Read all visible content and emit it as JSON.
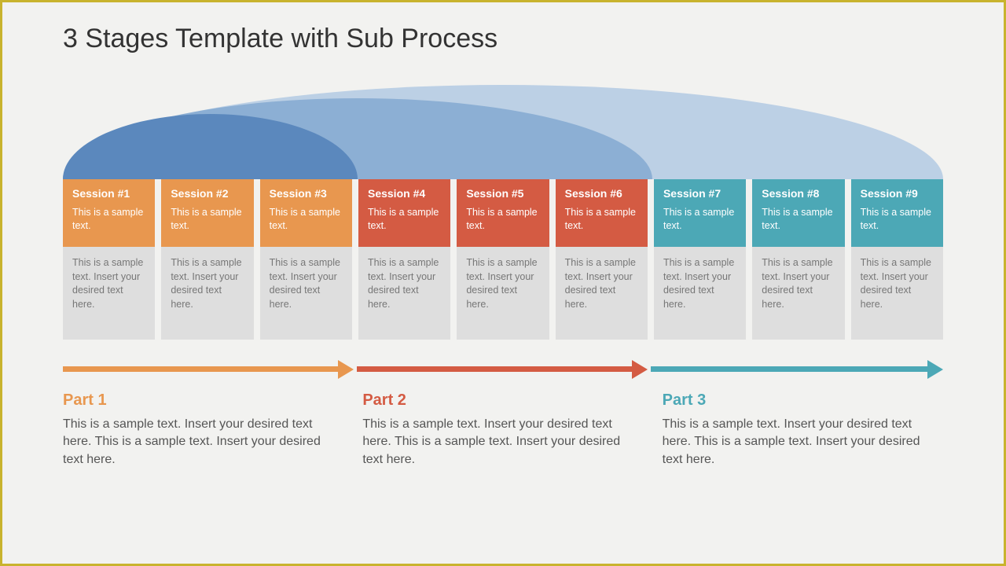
{
  "title": "3 Stages Template with Sub Process",
  "sessions": [
    {
      "title": "Session #1",
      "sub": "This is a sample text.",
      "detail": "This is a sample text. Insert your desired text here.",
      "tone": "orange"
    },
    {
      "title": "Session #2",
      "sub": "This is a sample text.",
      "detail": "This is a sample text. Insert your desired text here.",
      "tone": "orange"
    },
    {
      "title": "Session #3",
      "sub": "This is a sample text.",
      "detail": "This is a sample text. Insert your desired text here.",
      "tone": "orange"
    },
    {
      "title": "Session #4",
      "sub": "This is a sample text.",
      "detail": "This is a sample text. Insert your desired text here.",
      "tone": "red"
    },
    {
      "title": "Session #5",
      "sub": "This is a sample text.",
      "detail": "This is a sample text. Insert your desired text here.",
      "tone": "red"
    },
    {
      "title": "Session #6",
      "sub": "This is a sample text.",
      "detail": "This is a sample text. Insert your desired text here.",
      "tone": "red"
    },
    {
      "title": "Session #7",
      "sub": "This is a sample text.",
      "detail": "This is a sample text. Insert your desired text here.",
      "tone": "teal"
    },
    {
      "title": "Session #8",
      "sub": "This is a sample text.",
      "detail": "This is a sample text. Insert your desired text here.",
      "tone": "teal"
    },
    {
      "title": "Session #9",
      "sub": "This is a sample text.",
      "detail": "This is a sample text. Insert your desired text here.",
      "tone": "teal"
    }
  ],
  "parts": [
    {
      "title": "Part 1",
      "body": "This is a sample text.  Insert your desired text here. This is a sample text. Insert your desired text here.",
      "tone": "orange"
    },
    {
      "title": "Part 2",
      "body": "This is a sample text.  Insert your desired text here. This is a sample text. Insert your desired text here.",
      "tone": "red"
    },
    {
      "title": "Part 3",
      "body": "This is a sample text.  Insert your desired text here. This is a sample text. Insert your desired text here.",
      "tone": "teal"
    }
  ],
  "colors": {
    "orange": "#e8974f",
    "red": "#d45b43",
    "teal": "#4ca8b6"
  }
}
